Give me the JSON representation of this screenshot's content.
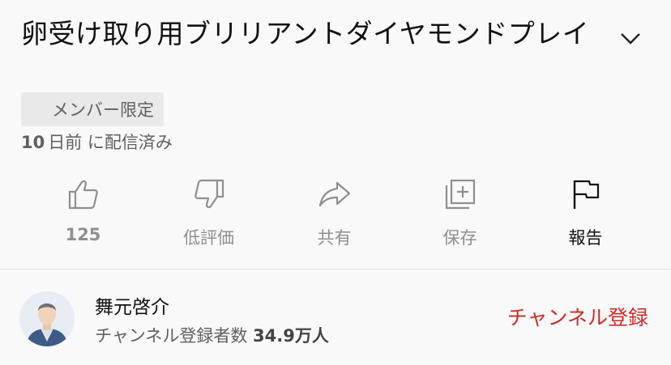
{
  "video": {
    "title": "卵受け取り用ブリリアントダイヤモンドプレイ",
    "badge": "メンバー限定",
    "published_prefix": "10",
    "published_suffix": "日前 に配信済み"
  },
  "actions": {
    "like": {
      "icon": "thumb-up-icon",
      "label": "125"
    },
    "dislike": {
      "icon": "thumb-down-icon",
      "label": "低評価"
    },
    "share": {
      "icon": "share-icon",
      "label": "共有"
    },
    "save": {
      "icon": "playlist-add-icon",
      "label": "保存"
    },
    "report": {
      "icon": "flag-icon",
      "label": "報告"
    }
  },
  "channel": {
    "name": "舞元啓介",
    "subs_prefix": "チャンネル登録者数 ",
    "subs_count": "34.9万人",
    "subscribe_label": "チャンネル登録"
  },
  "colors": {
    "background": "#f9f9f9",
    "subscribe": "#cc2b2b",
    "icon_gray": "#8f8f8f"
  }
}
